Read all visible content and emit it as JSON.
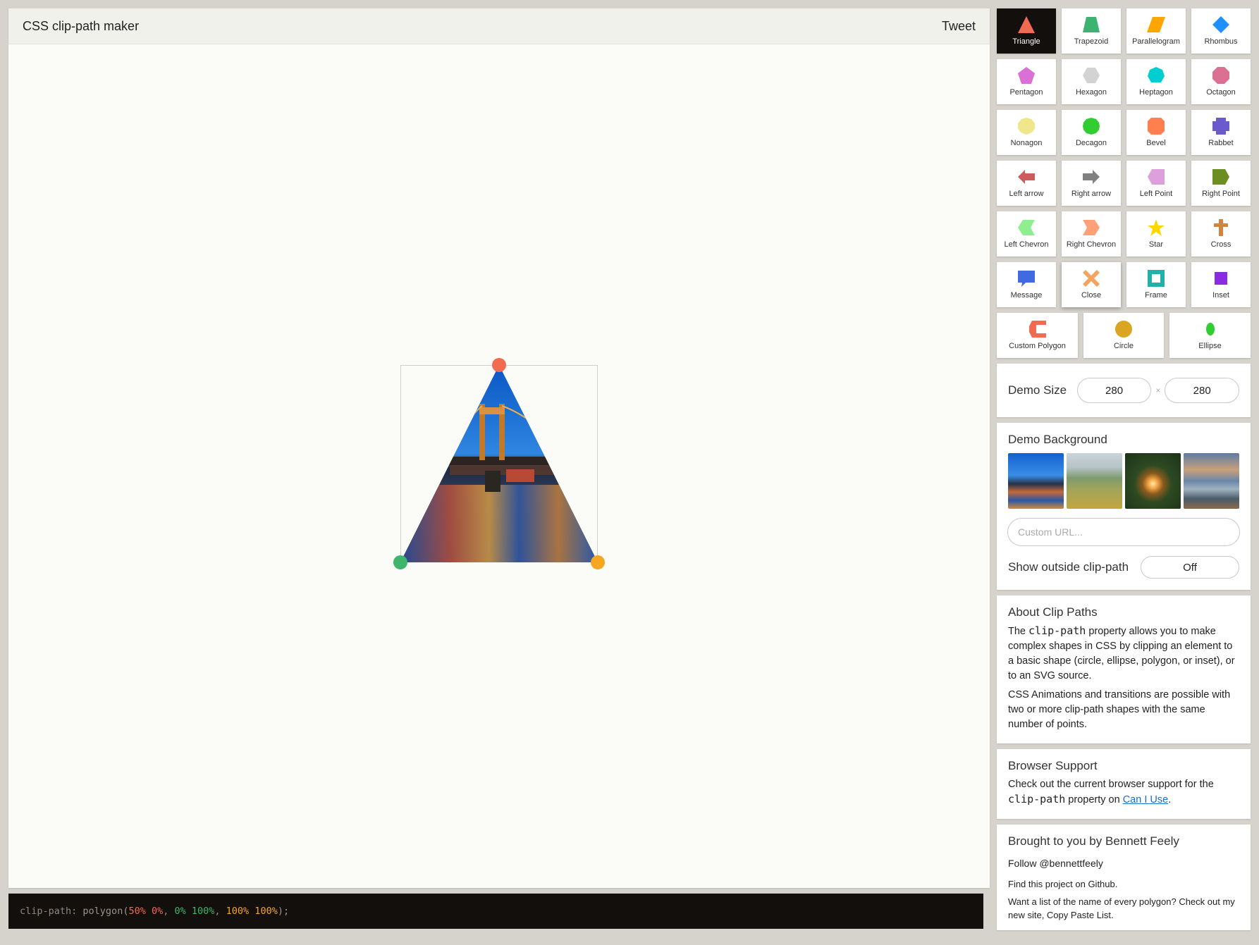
{
  "app": {
    "title": "CSS clip-path maker",
    "tweet_label": "Tweet"
  },
  "code": {
    "prop": "clip-path:",
    "fn_open": "polygon(",
    "p1": "50% 0%",
    "sep1": ", ",
    "p2": "0% 100%",
    "sep2": ", ",
    "p3": "100% 100%",
    "fn_close": ");",
    "colors": {
      "p1": "#f26a4f",
      "p2": "#3fb46b",
      "p3": "#f5a623"
    }
  },
  "shapes": [
    {
      "label": "Triangle",
      "icon": "triangle-icon",
      "color": "#f26a4f",
      "active": true
    },
    {
      "label": "Trapezoid",
      "icon": "trapezoid-icon",
      "color": "#3cb371"
    },
    {
      "label": "Parallelogram",
      "icon": "parallelogram-icon",
      "color": "#ffa500"
    },
    {
      "label": "Rhombus",
      "icon": "rhombus-icon",
      "color": "#1e90ff"
    },
    {
      "label": "Pentagon",
      "icon": "pentagon-icon",
      "color": "#da70d6"
    },
    {
      "label": "Hexagon",
      "icon": "hexagon-icon",
      "color": "#d3d3d3"
    },
    {
      "label": "Heptagon",
      "icon": "heptagon-icon",
      "color": "#00ced1"
    },
    {
      "label": "Octagon",
      "icon": "octagon-icon",
      "color": "#db7093"
    },
    {
      "label": "Nonagon",
      "icon": "nonagon-icon",
      "color": "#f0e68c"
    },
    {
      "label": "Decagon",
      "icon": "decagon-icon",
      "color": "#32cd32"
    },
    {
      "label": "Bevel",
      "icon": "bevel-icon",
      "color": "#ff7f50"
    },
    {
      "label": "Rabbet",
      "icon": "rabbet-icon",
      "color": "#6a5acd"
    },
    {
      "label": "Left arrow",
      "icon": "left-arrow-icon",
      "color": "#cd5c5c"
    },
    {
      "label": "Right arrow",
      "icon": "right-arrow-icon",
      "color": "#808080"
    },
    {
      "label": "Left Point",
      "icon": "left-point-icon",
      "color": "#dda0dd"
    },
    {
      "label": "Right Point",
      "icon": "right-point-icon",
      "color": "#6b8e23"
    },
    {
      "label": "Left Chevron",
      "icon": "left-chevron-icon",
      "color": "#90ee90"
    },
    {
      "label": "Right Chevron",
      "icon": "right-chevron-icon",
      "color": "#ffa07a"
    },
    {
      "label": "Star",
      "icon": "star-icon",
      "color": "#ffd700"
    },
    {
      "label": "Cross",
      "icon": "cross-icon",
      "color": "#cd853f"
    },
    {
      "label": "Message",
      "icon": "message-icon",
      "color": "#4169e1"
    },
    {
      "label": "Close",
      "icon": "close-icon",
      "color": "#f4a460",
      "hover": true
    },
    {
      "label": "Frame",
      "icon": "frame-icon",
      "color": "#20b2aa"
    },
    {
      "label": "Inset",
      "icon": "inset-icon",
      "color": "#8a2be2"
    }
  ],
  "shapes_bottom": [
    {
      "label": "Custom Polygon",
      "icon": "custom-polygon-icon",
      "color": "#f26a4f"
    },
    {
      "label": "Circle",
      "icon": "circle-icon",
      "color": "#daa520"
    },
    {
      "label": "Ellipse",
      "icon": "ellipse-icon",
      "color": "#32cd32"
    }
  ],
  "demo_size": {
    "label": "Demo Size",
    "width": "280",
    "height": "280",
    "times": "×"
  },
  "demo_background": {
    "title": "Demo Background",
    "thumbs": [
      "bridge-night-thumb",
      "green-hills-thumb",
      "sparkler-thumb",
      "ocean-waves-thumb"
    ],
    "url_placeholder": "Custom URL...",
    "show_outside_label": "Show outside clip-path",
    "show_outside_value": "Off"
  },
  "about": {
    "title": "About Clip Paths",
    "p1_a": "The ",
    "p1_code": "clip-path",
    "p1_b": " property allows you to make complex shapes in CSS by clipping an element to a basic shape (circle, ellipse, polygon, or inset), or to an SVG source.",
    "p2": "CSS Animations and transitions are possible with two or more clip-path shapes with the same number of points."
  },
  "support": {
    "title": "Browser Support",
    "text_a": "Check out the current browser support for the ",
    "code": "clip-path",
    "text_b": " property on ",
    "link": "Can I Use",
    "text_c": "."
  },
  "credit": {
    "title": "Brought to you by Bennett Feely",
    "follow": "Follow @bennettfeely",
    "github": "Find this project on Github.",
    "copy": "Want a list of the name of every polygon? Check out my new site, Copy Paste List."
  }
}
